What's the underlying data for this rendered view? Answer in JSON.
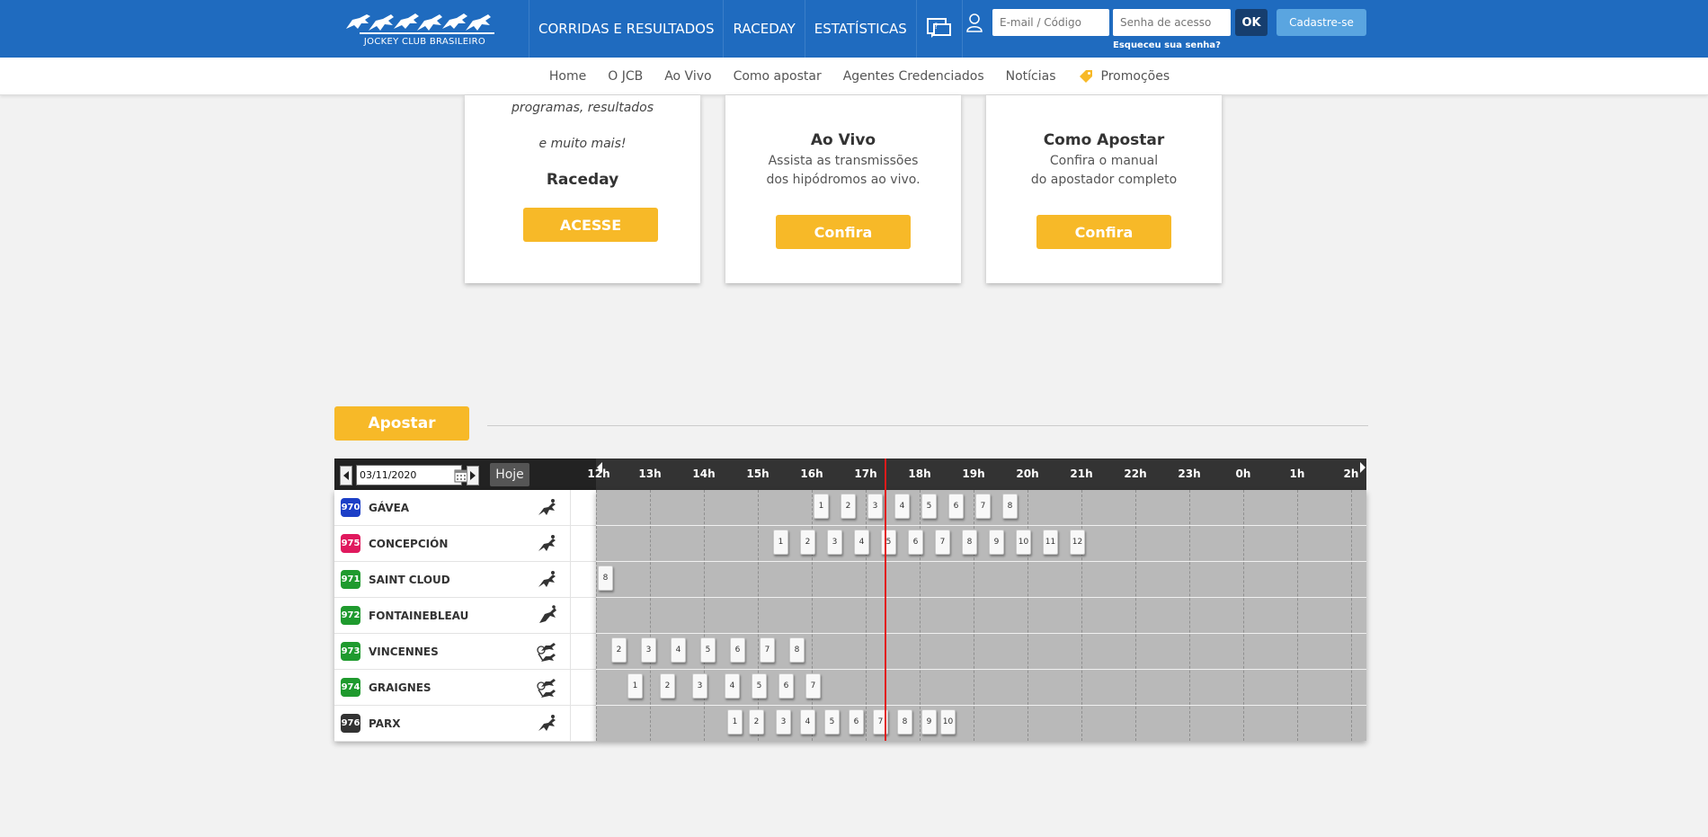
{
  "header": {
    "logo_text": "JOCKEY CLUB BRASILEIRO",
    "nav": [
      "CORRIDAS E RESULTADOS",
      "RACEDAY",
      "ESTATÍSTICAS"
    ],
    "help_icon": "help-chat-icon",
    "login": {
      "email_placeholder": "E-mail / Código",
      "password_placeholder": "Senha de acesso",
      "ok_label": "OK",
      "signup_label": "Cadastre-se",
      "forgot_label": "Esqueceu sua senha?"
    }
  },
  "subnav": {
    "items": [
      "Home",
      "O JCB",
      "Ao Vivo",
      "Como apostar",
      "Agentes Credenciados",
      "Notícias"
    ],
    "promo_label": "Promoções",
    "promo_color": "#f7b928"
  },
  "cards": {
    "raceday": {
      "line1": "programas, resultados",
      "line2": "e muito mais!",
      "title": "Raceday",
      "button": "ACESSE"
    },
    "aovivo": {
      "title": "Ao Vivo",
      "line1": "Assista as transmissões",
      "line2": "dos hipódromos ao vivo.",
      "button": "Confira"
    },
    "comoapostar": {
      "title": "Como Apostar",
      "line1": "Confira o manual",
      "line2": "do apostador completo",
      "button": "Confira"
    }
  },
  "apostar": {
    "button": "Apostar",
    "date": "03/11/2020",
    "today_label": "Hoje",
    "hours": [
      "12h",
      "13h",
      "14h",
      "15h",
      "16h",
      "17h",
      "18h",
      "19h",
      "20h",
      "21h",
      "22h",
      "23h",
      "0h",
      "1h",
      "2h"
    ],
    "tracks": [
      {
        "code": "970",
        "name": "GÁVEA",
        "color": "#1c3fc7",
        "sport": "gallop",
        "races": [
          {
            "n": "1",
            "t": 16.0
          },
          {
            "n": "2",
            "t": 16.5
          },
          {
            "n": "3",
            "t": 17.0
          },
          {
            "n": "4",
            "t": 17.5
          },
          {
            "n": "5",
            "t": 18.0
          },
          {
            "n": "6",
            "t": 18.5
          },
          {
            "n": "7",
            "t": 19.0
          },
          {
            "n": "8",
            "t": 19.5
          }
        ]
      },
      {
        "code": "975",
        "name": "CONCEPCIÓN",
        "color": "#e0195e",
        "sport": "gallop",
        "races": [
          {
            "n": "1",
            "t": 15.25
          },
          {
            "n": "2",
            "t": 15.75
          },
          {
            "n": "3",
            "t": 16.25
          },
          {
            "n": "4",
            "t": 16.75
          },
          {
            "n": "5",
            "t": 17.25
          },
          {
            "n": "6",
            "t": 17.75
          },
          {
            "n": "7",
            "t": 18.25
          },
          {
            "n": "8",
            "t": 18.75
          },
          {
            "n": "9",
            "t": 19.25
          },
          {
            "n": "10",
            "t": 19.75
          },
          {
            "n": "11",
            "t": 20.25
          },
          {
            "n": "12",
            "t": 20.75
          }
        ]
      },
      {
        "code": "971",
        "name": "SAINT CLOUD",
        "color": "#1f9a2e",
        "sport": "gallop",
        "races": [
          {
            "n": "8",
            "t": 12.0
          }
        ]
      },
      {
        "code": "972",
        "name": "FONTAINEBLEAU",
        "color": "#1f9a2e",
        "sport": "jump",
        "races": []
      },
      {
        "code": "973",
        "name": "VINCENNES",
        "color": "#1f9a2e",
        "sport": "trot",
        "races": [
          {
            "n": "2",
            "t": 12.25
          },
          {
            "n": "3",
            "t": 12.8
          },
          {
            "n": "4",
            "t": 13.35
          },
          {
            "n": "5",
            "t": 13.9
          },
          {
            "n": "6",
            "t": 14.45
          },
          {
            "n": "7",
            "t": 15.0
          },
          {
            "n": "8",
            "t": 15.55
          }
        ]
      },
      {
        "code": "974",
        "name": "GRAIGNES",
        "color": "#1f9a2e",
        "sport": "trot",
        "races": [
          {
            "n": "1",
            "t": 12.55
          },
          {
            "n": "2",
            "t": 13.15
          },
          {
            "n": "3",
            "t": 13.75
          },
          {
            "n": "4",
            "t": 14.35
          },
          {
            "n": "5",
            "t": 14.85
          },
          {
            "n": "6",
            "t": 15.35
          },
          {
            "n": "7",
            "t": 15.85
          }
        ]
      },
      {
        "code": "976",
        "name": "PARX",
        "color": "#333333",
        "sport": "gallop",
        "races": [
          {
            "n": "1",
            "t": 14.4
          },
          {
            "n": "2",
            "t": 14.8
          },
          {
            "n": "3",
            "t": 15.3
          },
          {
            "n": "4",
            "t": 15.75
          },
          {
            "n": "5",
            "t": 16.2
          },
          {
            "n": "6",
            "t": 16.65
          },
          {
            "n": "7",
            "t": 17.1
          },
          {
            "n": "8",
            "t": 17.55
          },
          {
            "n": "9",
            "t": 18.0
          },
          {
            "n": "10",
            "t": 18.35
          }
        ]
      }
    ],
    "now_time": 17.35,
    "now_color": "#e21b1b"
  }
}
